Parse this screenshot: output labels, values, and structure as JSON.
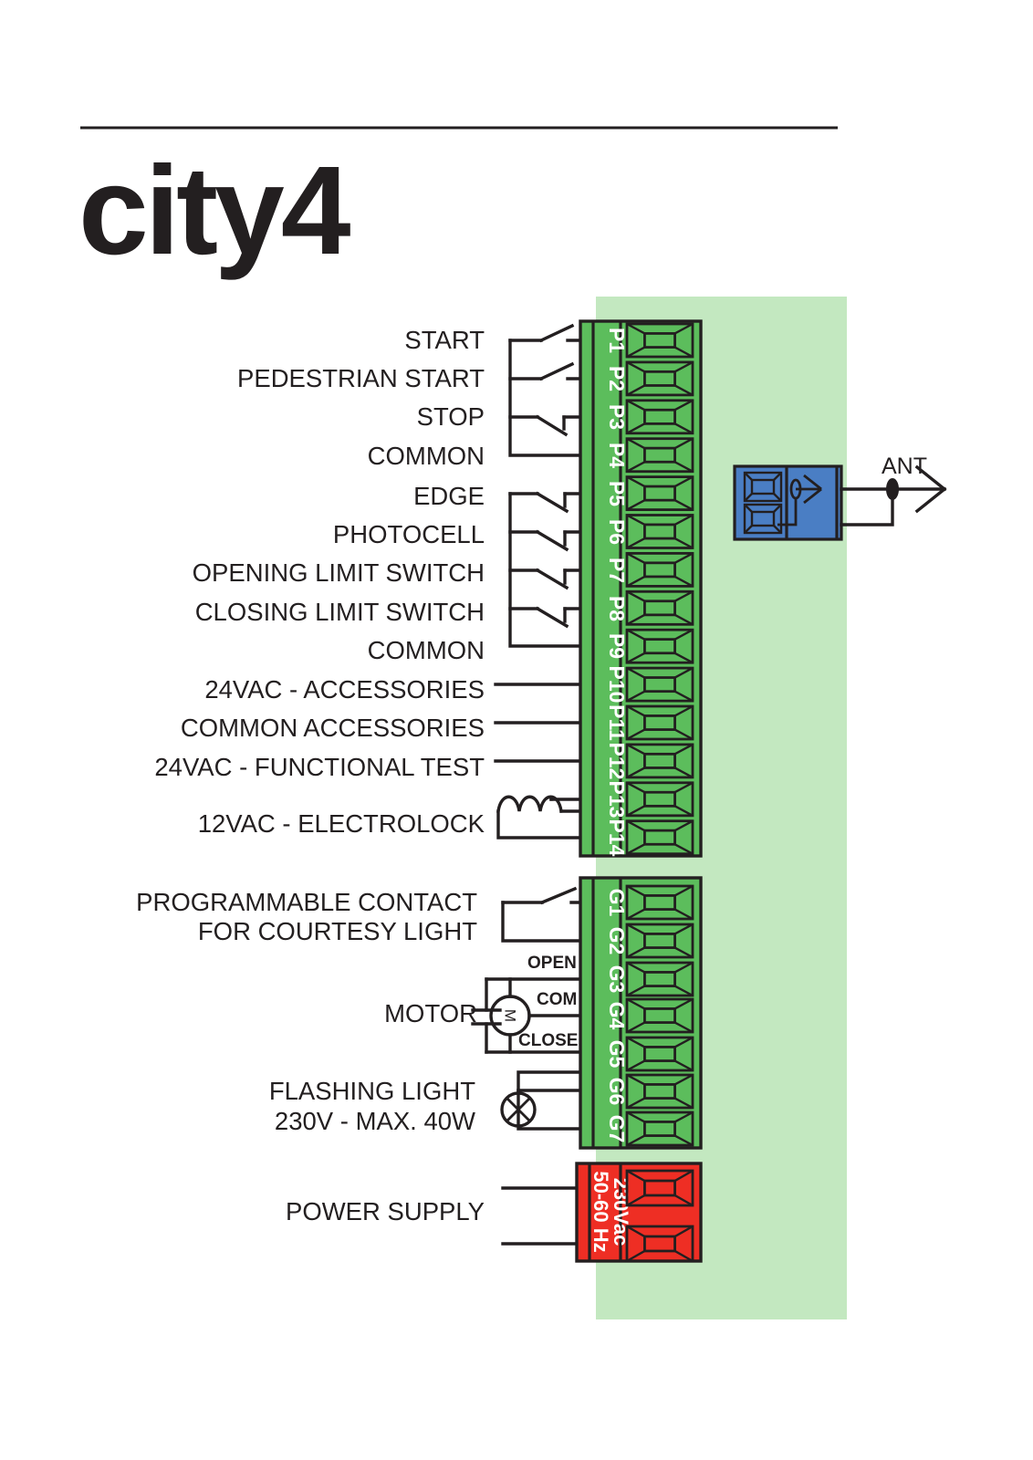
{
  "page": {
    "title": "city4",
    "logo_text": "city4",
    "background_color": "#ffffff",
    "divider_color": "#231f20"
  },
  "colors": {
    "terminal_green": "#5cbd5c",
    "panel_green": "#c3e8c0",
    "terminal_red": "#ee2e24",
    "antenna_blue": "#4a7ec4",
    "ink": "#231f20",
    "white": "#ffffff"
  },
  "diagram": {
    "name": "city4 control board terminal wiring diagram",
    "low_voltage_block": {
      "name": "low-voltage-terminal-block",
      "color": "#5cbd5c",
      "terminals": [
        {
          "id": "P1",
          "label": "START",
          "symbol": "no-contact"
        },
        {
          "id": "P2",
          "label": "PEDESTRIAN START",
          "symbol": "no-contact"
        },
        {
          "id": "P3",
          "label": "STOP",
          "symbol": "nc-contact"
        },
        {
          "id": "P4",
          "label": "COMMON",
          "symbol": "bus"
        },
        {
          "id": "P5",
          "label": "EDGE",
          "symbol": "nc-contact"
        },
        {
          "id": "P6",
          "label": "PHOTOCELL",
          "symbol": "nc-contact"
        },
        {
          "id": "P7",
          "label": "OPENING LIMIT SWITCH",
          "symbol": "nc-contact"
        },
        {
          "id": "P8",
          "label": "CLOSING LIMIT SWITCH",
          "symbol": "nc-contact"
        },
        {
          "id": "P9",
          "label": "COMMON",
          "symbol": "bus"
        },
        {
          "id": "P10",
          "label": "24VAC - ACCESSORIES",
          "symbol": "plain-wire"
        },
        {
          "id": "P11",
          "label": "COMMON ACCESSORIES",
          "symbol": "plain-wire"
        },
        {
          "id": "P12",
          "label": "24VAC - FUNCTIONAL TEST",
          "symbol": "plain-wire"
        },
        {
          "id": "P13",
          "label": "12VAC - ELECTROLOCK",
          "symbol": "coil"
        },
        {
          "id": "P14",
          "label": "",
          "symbol": "coil-return"
        }
      ]
    },
    "motor_block": {
      "name": "motor-terminal-block",
      "color": "#5cbd5c",
      "terminals": [
        {
          "id": "G1",
          "label": "PROGRAMMABLE CONTACT",
          "symbol": "no-contact"
        },
        {
          "id": "G2",
          "label": "FOR COURTESY LIGHT",
          "symbol": "no-contact-return"
        },
        {
          "id": "G3",
          "label": "OPEN",
          "symbol": "motor-open"
        },
        {
          "id": "G4",
          "label": "COM",
          "symbol": "motor-com"
        },
        {
          "id": "G5",
          "label": "CLOSE",
          "symbol": "motor-close"
        },
        {
          "id": "G6",
          "label": "",
          "symbol": "lamp"
        },
        {
          "id": "G7",
          "label": "",
          "symbol": "lamp-return"
        }
      ],
      "groups": [
        {
          "name": "programmable-contact",
          "lines": [
            "PROGRAMMABLE CONTACT",
            "FOR COURTESY LIGHT"
          ]
        },
        {
          "name": "motor",
          "lines": [
            "MOTOR"
          ],
          "lead_labels": [
            "OPEN",
            "COM",
            "CLOSE"
          ],
          "symbol_letter": "M"
        },
        {
          "name": "flashing-light",
          "lines": [
            "FLASHING LIGHT",
            "230V - MAX. 40W"
          ]
        }
      ]
    },
    "power_block": {
      "name": "power-supply-terminal-block",
      "color": "#ee2e24",
      "label": "POWER SUPPLY",
      "rating_line_1": "230Vac",
      "rating_line_2": "50-60 Hz",
      "terminal_count": 2
    },
    "antenna_block": {
      "name": "antenna-connector",
      "color": "#4a7ec4",
      "label": "ANT",
      "terminal_count": 2
    }
  }
}
